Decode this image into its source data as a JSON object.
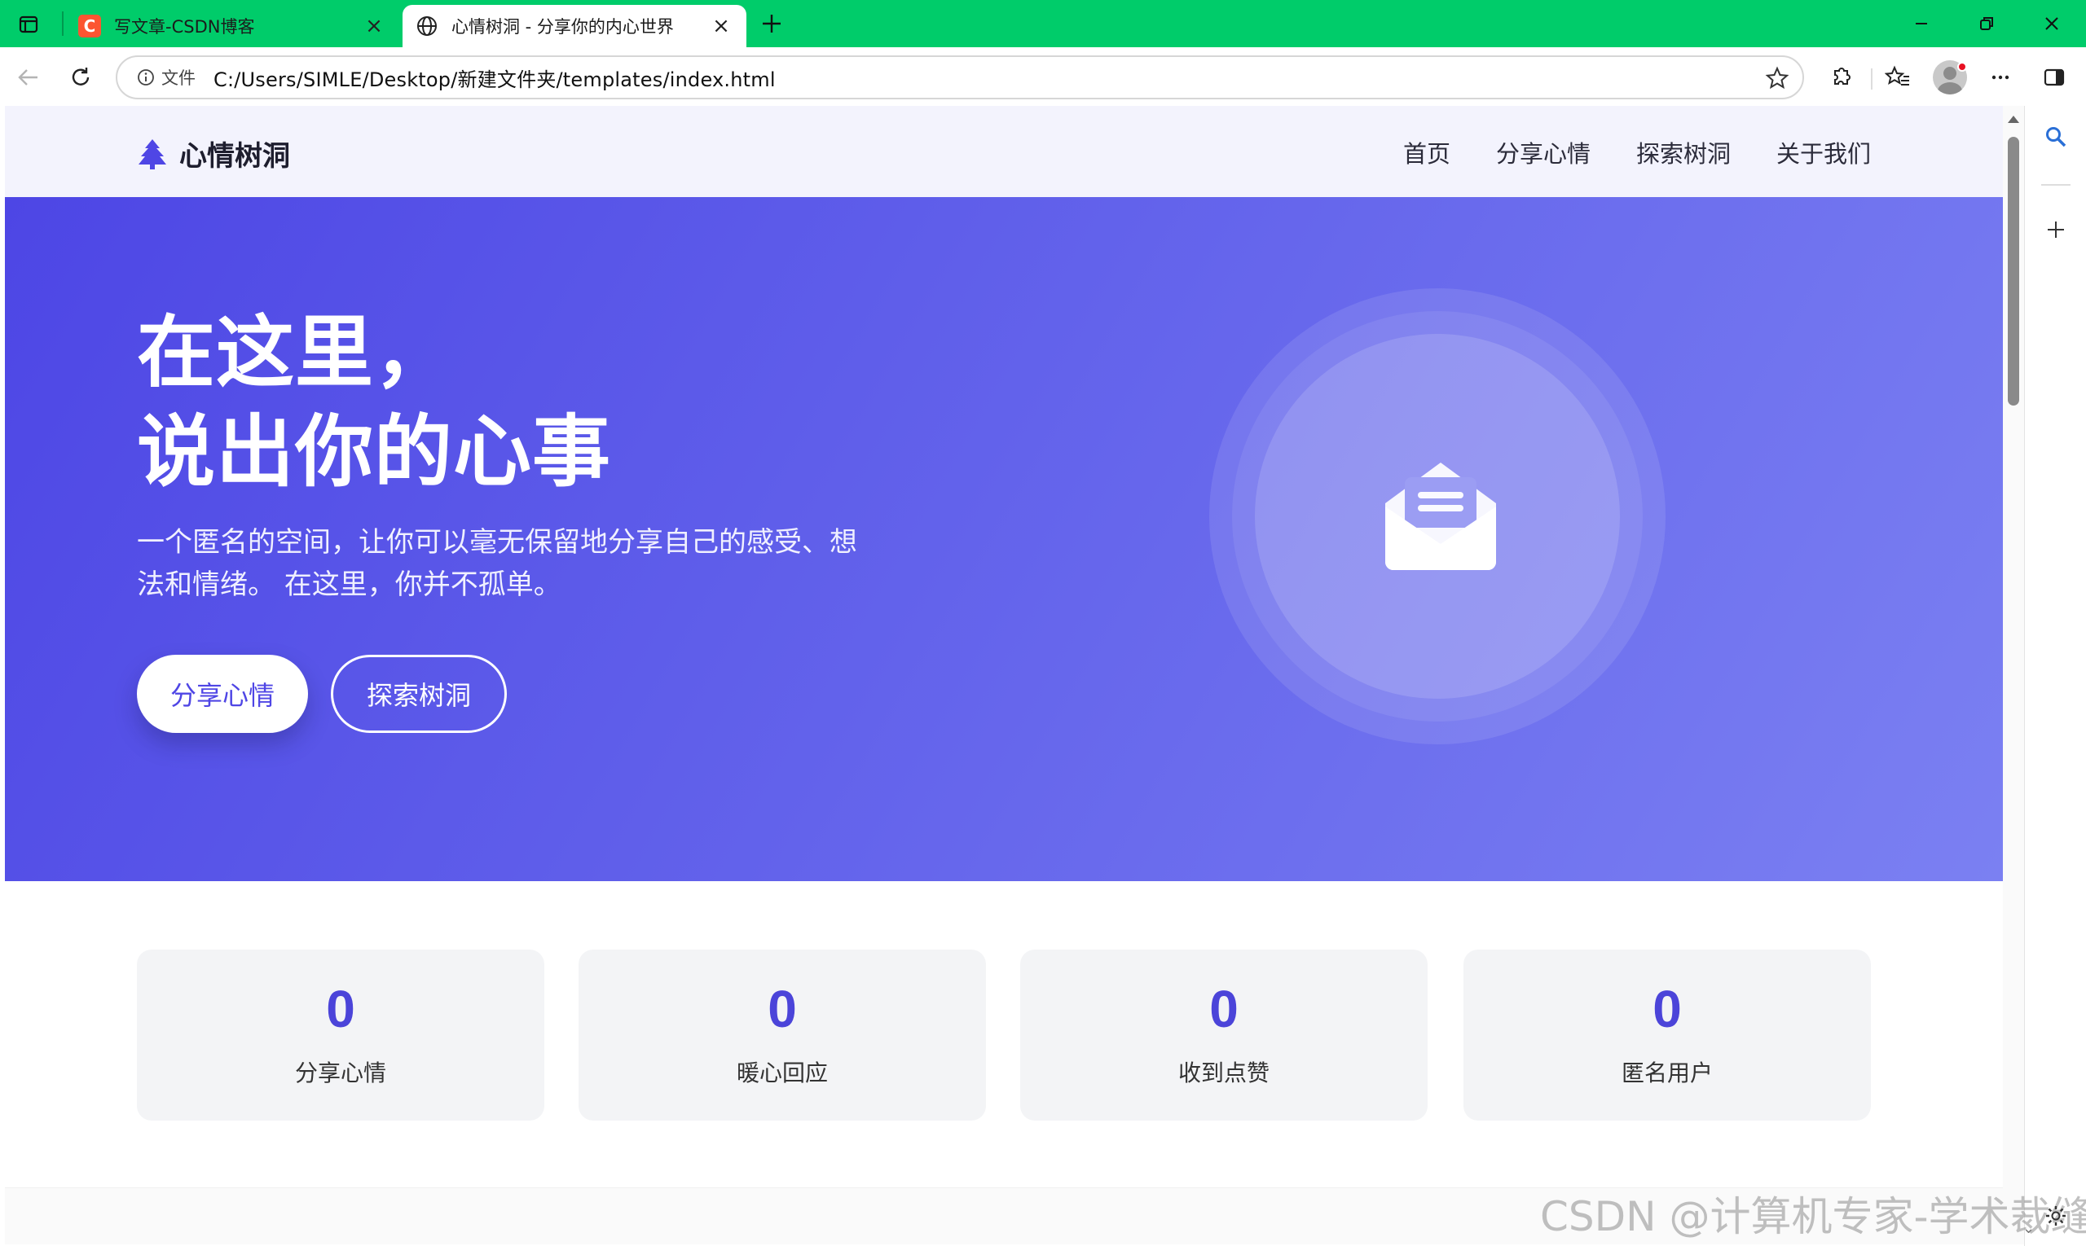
{
  "browser": {
    "tabs": [
      {
        "title": "写文章-CSDN博客",
        "favicon": "csdn-icon",
        "active": false
      },
      {
        "title": "心情树洞 - 分享你的内心世界",
        "favicon": "globe-icon",
        "active": true
      }
    ],
    "address": {
      "security_label": "文件",
      "url": "C:/Users/SIMLE/Desktop/新建文件夹/templates/index.html"
    },
    "favicon_letter": "C"
  },
  "site": {
    "brand": "心情树洞",
    "nav": [
      "首页",
      "分享心情",
      "探索树洞",
      "关于我们"
    ],
    "hero": {
      "title_line1": "在这里，",
      "title_line2": "说出你的心事",
      "subtitle": "一个匿名的空间，让你可以毫无保留地分享自己的感受、想法和情绪。 在这里，你并不孤单。",
      "primary_button": "分享心情",
      "secondary_button": "探索树洞"
    },
    "stats": [
      {
        "value": "0",
        "label": "分享心情"
      },
      {
        "value": "0",
        "label": "暖心回应"
      },
      {
        "value": "0",
        "label": "收到点赞"
      },
      {
        "value": "0",
        "label": "匿名用户"
      }
    ]
  },
  "watermark": "CSDN @计算机专家-学术裁缝",
  "colors": {
    "tabbar": "#00cc6a",
    "accent": "#4f46e5",
    "hero_start": "#4d46e5",
    "hero_end": "#7b80f2"
  }
}
